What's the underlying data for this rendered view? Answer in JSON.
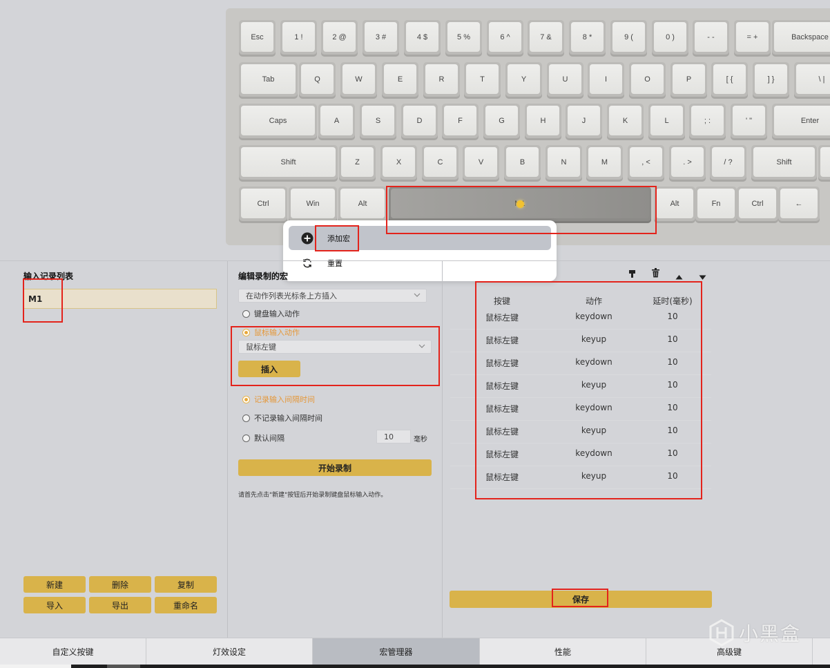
{
  "keyboard": {
    "rows": [
      [
        "Esc",
        "1 !",
        "2 @",
        "3 #",
        "4 $",
        "5 %",
        "6 ^",
        "7 &",
        "8 *",
        "9 (",
        "0 )",
        "- -",
        "= +",
        "Backspace"
      ],
      [
        "Tab",
        "Q",
        "W",
        "E",
        "R",
        "T",
        "Y",
        "U",
        "I",
        "O",
        "P",
        "[ {",
        "] }",
        "\\ |"
      ],
      [
        "Caps",
        "A",
        "S",
        "D",
        "F",
        "G",
        "H",
        "J",
        "K",
        "L",
        "; :",
        "' \"",
        "Enter"
      ],
      [
        "Shift",
        "Z",
        "X",
        "C",
        "V",
        "B",
        "N",
        "M",
        ", <",
        ". >",
        "/ ?",
        "Shift"
      ],
      [
        "Ctrl",
        "Win",
        "Alt",
        "M1",
        "Alt",
        "Fn",
        "Ctrl",
        "←"
      ]
    ],
    "space_label": "M1"
  },
  "context_menu": {
    "add_macro": "添加宏",
    "reset": "重置"
  },
  "record_list": {
    "title": "输入记录列表",
    "items": [
      "M1"
    ],
    "buttons": {
      "new": "新建",
      "delete": "删除",
      "copy": "复制",
      "import": "导入",
      "export": "导出",
      "rename": "重命名"
    }
  },
  "editor": {
    "title": "编辑录制的宏",
    "insert_mode": "在动作列表光标条上方插入",
    "keyboard_input": "键盘输入动作",
    "mouse_input": "鼠标输入动作",
    "mouse_select": "鼠标左键",
    "insert_button": "插入",
    "record_interval": "记录输入间隔时间",
    "no_record_interval": "不记录输入间隔时间",
    "default_interval": "默认间隔",
    "interval_value": "10",
    "interval_unit": "毫秒",
    "start_record": "开始录制",
    "hint": "请首先点击\"新建\"按钮后开始录制键盘鼠标输入动作。"
  },
  "actions": {
    "headers": [
      "按键",
      "动作",
      "延时(毫秒)"
    ],
    "rows": [
      [
        "鼠标左键",
        "keydown",
        "10"
      ],
      [
        "鼠标左键",
        "keyup",
        "10"
      ],
      [
        "鼠标左键",
        "keydown",
        "10"
      ],
      [
        "鼠标左键",
        "keyup",
        "10"
      ],
      [
        "鼠标左键",
        "keydown",
        "10"
      ],
      [
        "鼠标左键",
        "keyup",
        "10"
      ],
      [
        "鼠标左键",
        "keydown",
        "10"
      ],
      [
        "鼠标左键",
        "keyup",
        "10"
      ]
    ],
    "save": "保存"
  },
  "tabs": [
    "自定义按键",
    "灯效设定",
    "宏管理器",
    "性能",
    "高级键"
  ],
  "active_tab": 2,
  "watermark": "小黑盒",
  "colors": {
    "accent_button": "#d9b34a",
    "annotation_red": "#e3231b",
    "radio_selected": "#e5983a",
    "active_tab_bg": "#b9bcc2"
  }
}
